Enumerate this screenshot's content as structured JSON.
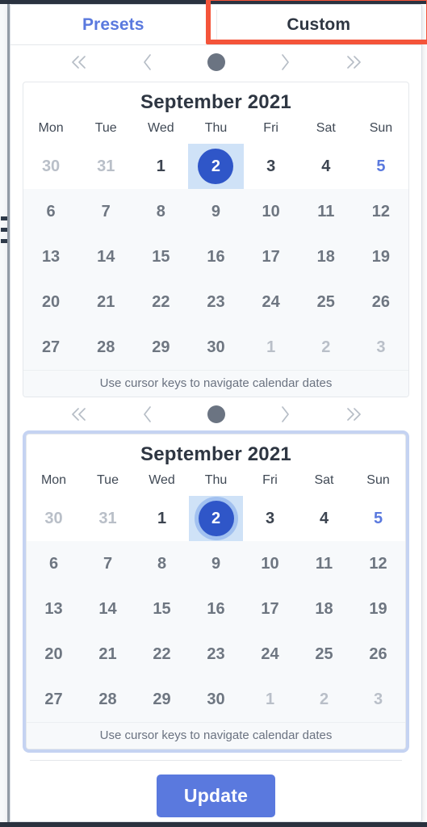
{
  "colors": {
    "accent_blue": "#5a79de",
    "selected_blue": "#2f56c8",
    "selected_cell_bg": "#cfe2f7",
    "focus_ring": "#c5d3f2",
    "annotation_red": "#f4543a",
    "text_dark": "#2e3642",
    "text_muted": "#b9bfc8",
    "row_tint": "#f7f9fb"
  },
  "tabs": [
    {
      "label": "Presets",
      "active": false,
      "name": "tab-presets"
    },
    {
      "label": "Custom",
      "active": true,
      "name": "tab-custom"
    }
  ],
  "nav": {
    "prev_year_icon": "double-chevron-left-icon",
    "prev_month_icon": "chevron-left-icon",
    "today_dot_icon": "today-dot-icon",
    "next_month_icon": "chevron-right-icon",
    "next_year_icon": "double-chevron-right-icon"
  },
  "calendars": [
    {
      "id": "start-date-calendar",
      "title": "September 2021",
      "focused": false,
      "footer": "Use cursor keys to navigate calendar dates",
      "weekdays": [
        "Mon",
        "Tue",
        "Wed",
        "Thu",
        "Fri",
        "Sat",
        "Sun"
      ],
      "weeks": [
        [
          {
            "d": "30",
            "state": "outside"
          },
          {
            "d": "31",
            "state": "outside"
          },
          {
            "d": "1",
            "state": "normal"
          },
          {
            "d": "2",
            "state": "selected"
          },
          {
            "d": "3",
            "state": "normal"
          },
          {
            "d": "4",
            "state": "normal"
          },
          {
            "d": "5",
            "state": "link"
          }
        ],
        [
          {
            "d": "6",
            "state": "normal"
          },
          {
            "d": "7",
            "state": "normal"
          },
          {
            "d": "8",
            "state": "normal"
          },
          {
            "d": "9",
            "state": "normal"
          },
          {
            "d": "10",
            "state": "normal"
          },
          {
            "d": "11",
            "state": "normal"
          },
          {
            "d": "12",
            "state": "normal"
          }
        ],
        [
          {
            "d": "13",
            "state": "normal"
          },
          {
            "d": "14",
            "state": "normal"
          },
          {
            "d": "15",
            "state": "normal"
          },
          {
            "d": "16",
            "state": "normal"
          },
          {
            "d": "17",
            "state": "normal"
          },
          {
            "d": "18",
            "state": "normal"
          },
          {
            "d": "19",
            "state": "normal"
          }
        ],
        [
          {
            "d": "20",
            "state": "normal"
          },
          {
            "d": "21",
            "state": "normal"
          },
          {
            "d": "22",
            "state": "normal"
          },
          {
            "d": "23",
            "state": "normal"
          },
          {
            "d": "24",
            "state": "normal"
          },
          {
            "d": "25",
            "state": "normal"
          },
          {
            "d": "26",
            "state": "normal"
          }
        ],
        [
          {
            "d": "27",
            "state": "normal"
          },
          {
            "d": "28",
            "state": "normal"
          },
          {
            "d": "29",
            "state": "normal"
          },
          {
            "d": "30",
            "state": "normal"
          },
          {
            "d": "1",
            "state": "outside"
          },
          {
            "d": "2",
            "state": "outside"
          },
          {
            "d": "3",
            "state": "outside"
          }
        ]
      ]
    },
    {
      "id": "end-date-calendar",
      "title": "September 2021",
      "focused": true,
      "footer": "Use cursor keys to navigate calendar dates",
      "weekdays": [
        "Mon",
        "Tue",
        "Wed",
        "Thu",
        "Fri",
        "Sat",
        "Sun"
      ],
      "weeks": [
        [
          {
            "d": "30",
            "state": "outside"
          },
          {
            "d": "31",
            "state": "outside"
          },
          {
            "d": "1",
            "state": "normal"
          },
          {
            "d": "2",
            "state": "selected-focused"
          },
          {
            "d": "3",
            "state": "normal"
          },
          {
            "d": "4",
            "state": "normal"
          },
          {
            "d": "5",
            "state": "link"
          }
        ],
        [
          {
            "d": "6",
            "state": "normal"
          },
          {
            "d": "7",
            "state": "normal"
          },
          {
            "d": "8",
            "state": "normal"
          },
          {
            "d": "9",
            "state": "normal"
          },
          {
            "d": "10",
            "state": "normal"
          },
          {
            "d": "11",
            "state": "normal"
          },
          {
            "d": "12",
            "state": "normal"
          }
        ],
        [
          {
            "d": "13",
            "state": "normal"
          },
          {
            "d": "14",
            "state": "normal"
          },
          {
            "d": "15",
            "state": "normal"
          },
          {
            "d": "16",
            "state": "normal"
          },
          {
            "d": "17",
            "state": "normal"
          },
          {
            "d": "18",
            "state": "normal"
          },
          {
            "d": "19",
            "state": "normal"
          }
        ],
        [
          {
            "d": "20",
            "state": "normal"
          },
          {
            "d": "21",
            "state": "normal"
          },
          {
            "d": "22",
            "state": "normal"
          },
          {
            "d": "23",
            "state": "normal"
          },
          {
            "d": "24",
            "state": "normal"
          },
          {
            "d": "25",
            "state": "normal"
          },
          {
            "d": "26",
            "state": "normal"
          }
        ],
        [
          {
            "d": "27",
            "state": "normal"
          },
          {
            "d": "28",
            "state": "normal"
          },
          {
            "d": "29",
            "state": "normal"
          },
          {
            "d": "30",
            "state": "normal"
          },
          {
            "d": "1",
            "state": "outside"
          },
          {
            "d": "2",
            "state": "outside"
          },
          {
            "d": "3",
            "state": "outside"
          }
        ]
      ]
    }
  ],
  "footer": {
    "update_label": "Update"
  }
}
